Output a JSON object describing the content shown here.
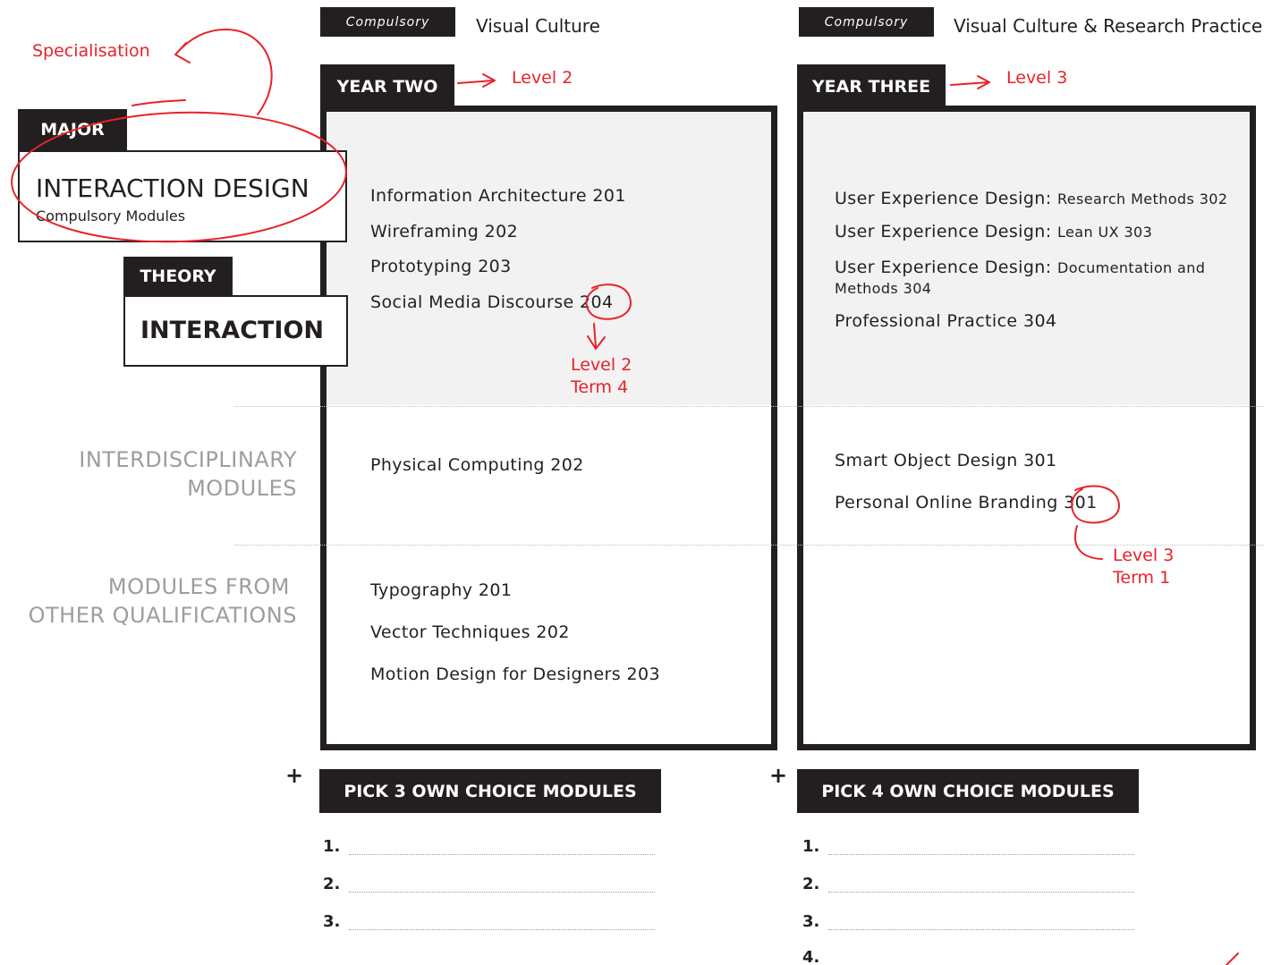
{
  "year2": {
    "compulsory_tag": "Compulsory",
    "compulsory_text": "Visual Culture",
    "year_tag": "YEAR TWO",
    "major_modules": [
      "Information Architecture 201",
      "Wireframing 202",
      "Prototyping 203",
      "Social Media Discourse 204"
    ],
    "interdisciplinary_modules": [
      "Physical Computing 202"
    ],
    "other_modules": [
      "Typography 201",
      "Vector Techniques 202",
      "Motion Design for Designers 203"
    ],
    "pick_label": "PICK 3 OWN CHOICE MODULES",
    "pick_numbers": [
      "1.",
      "2.",
      "3."
    ]
  },
  "year3": {
    "compulsory_tag": "Compulsory",
    "compulsory_text": "Visual Culture & Research Practice",
    "year_tag": "YEAR THREE",
    "major_modules": [
      {
        "main": "User Experience Design:",
        "sub": "Research Methods 302"
      },
      {
        "main": "User Experience Design:",
        "sub": "Lean UX 303"
      },
      {
        "main": "User Experience Design:",
        "sub": "Documentation and",
        "sub2": "Methods 304"
      },
      {
        "main": "Professional Practice 304"
      }
    ],
    "interdisciplinary_modules": [
      "Smart Object Design 301",
      "Personal Online Branding 301"
    ],
    "pick_label": "PICK 4 OWN CHOICE MODULES",
    "pick_numbers": [
      "1.",
      "2.",
      "3.",
      "4."
    ]
  },
  "left": {
    "major_tag": "MAJOR",
    "major_title": "INTERACTION DESIGN",
    "major_sub": "Compulsory Modules",
    "theory_tag": "THEORY",
    "theory_title": "INTERACTION",
    "interdisciplinary_label": [
      "INTERDISCIPLINARY",
      "MODULES"
    ],
    "other_label": [
      "MODULES FROM",
      "OTHER QUALIFICATIONS"
    ]
  },
  "plus": "+",
  "annotations": {
    "specialisation": "Specialisation",
    "level2": "Level 2",
    "level3": "Level 3",
    "y2_note": [
      "Level 2",
      "Term 4"
    ],
    "y3_note": [
      "Level 3",
      "Term 1"
    ]
  },
  "colors": {
    "ink": "#231f20",
    "annotation": "#e8222a",
    "muted": "#9d9d9d",
    "shade": "#f2f2f2"
  }
}
